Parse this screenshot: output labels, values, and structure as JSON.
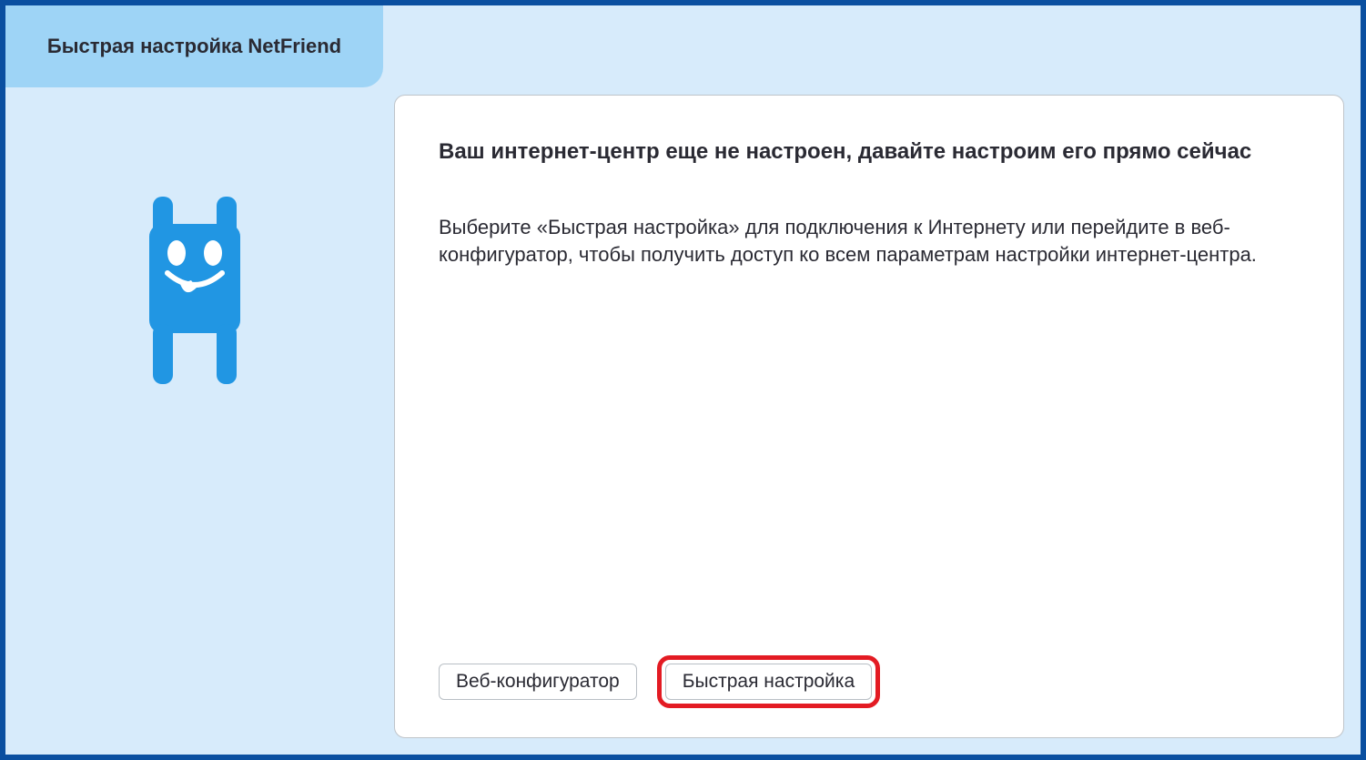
{
  "tab": {
    "title": "Быстрая настройка NetFriend"
  },
  "sidebar": {
    "mascot_icon_name": "netfriend-mascot-icon"
  },
  "main": {
    "title": "Ваш интернет-центр еще не настроен, давайте настроим его прямо сейчас",
    "description": "Выберите «Быстрая настройка» для подключения к Интернету или перейдите в веб-конфигуратор, чтобы получить доступ ко всем параметрам настройки интернет-центра."
  },
  "buttons": {
    "web_configurator": "Веб-конфигуратор",
    "quick_setup": "Быстрая настройка"
  },
  "colors": {
    "frame_border": "#0a4fa0",
    "panel_bg": "#d7ebfb",
    "tab_bg": "#9ed4f6",
    "mascot": "#2196e3",
    "highlight": "#e31b23",
    "text": "#2a2a33"
  }
}
